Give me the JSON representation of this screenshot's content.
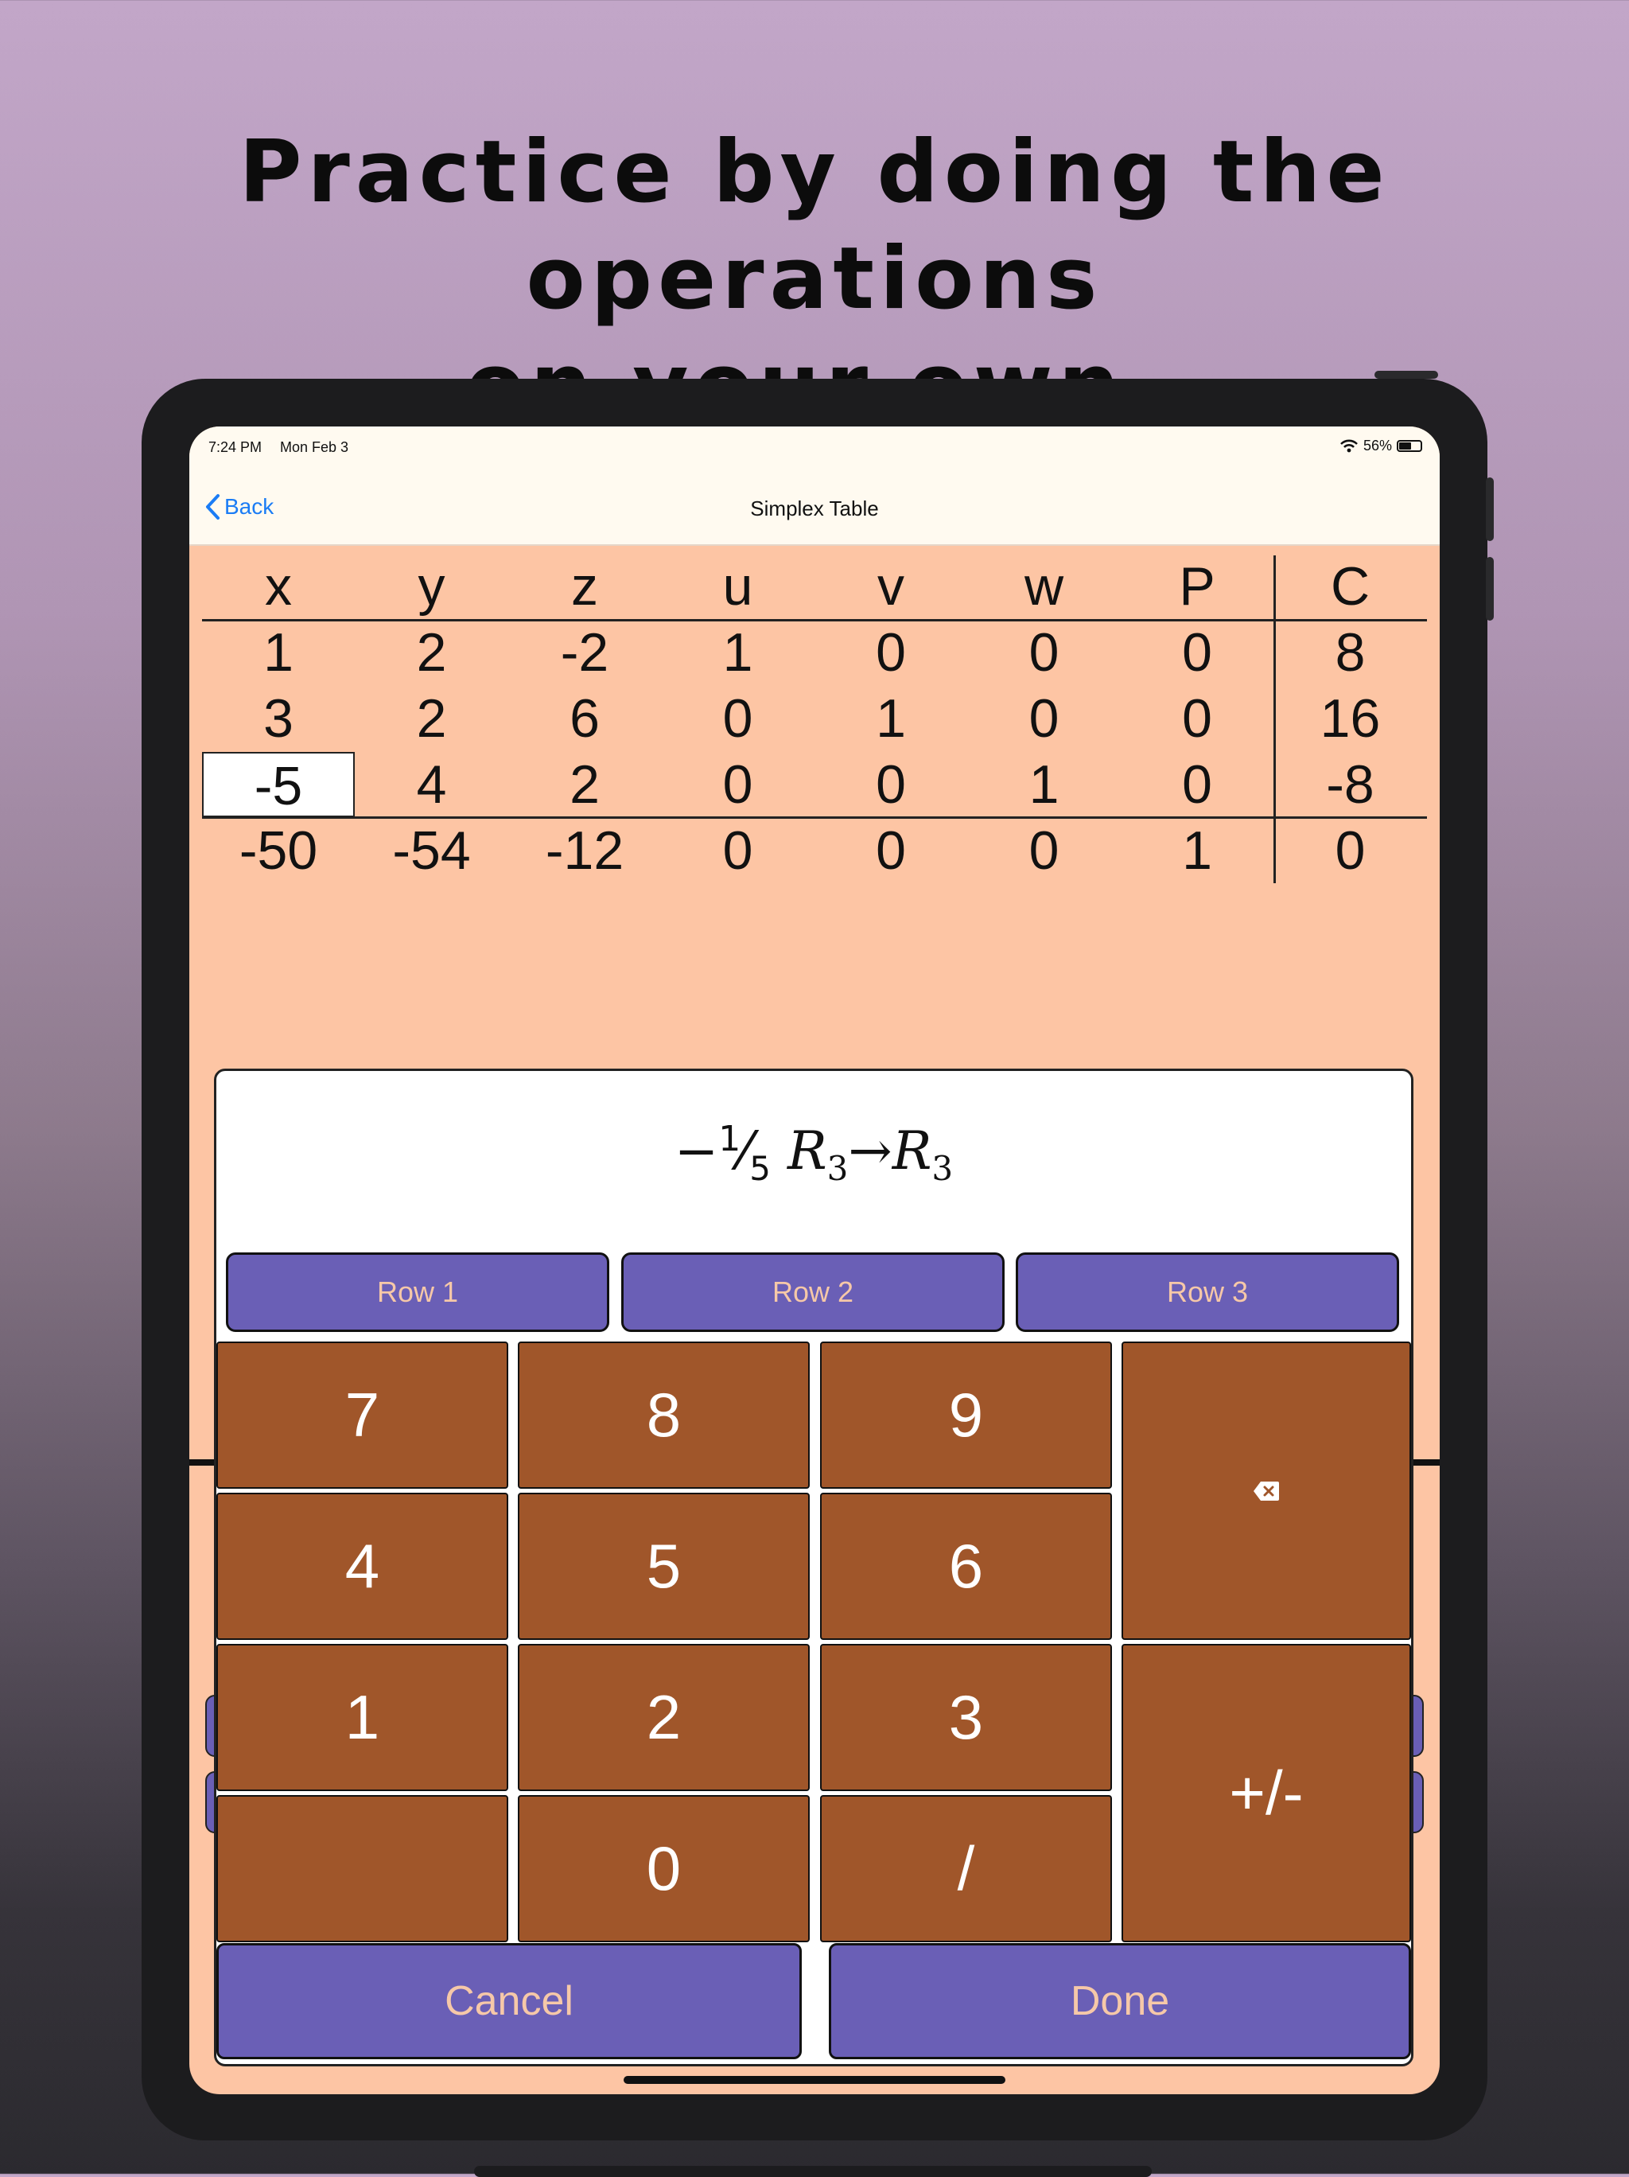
{
  "caption": {
    "line1": "Practice by doing the operations",
    "line2": "on your own."
  },
  "status_bar": {
    "time": "7:24 PM",
    "date": "Mon Feb 3",
    "battery": "56%"
  },
  "nav": {
    "back_label": "Back",
    "title": "Simplex Table"
  },
  "tableau": {
    "headers": [
      "x",
      "y",
      "z",
      "u",
      "v",
      "w",
      "P",
      "C"
    ],
    "rows": [
      [
        "1",
        "2",
        "-2",
        "1",
        "0",
        "0",
        "0",
        "8"
      ],
      [
        "3",
        "2",
        "6",
        "0",
        "1",
        "0",
        "0",
        "16"
      ],
      [
        "-5",
        "4",
        "2",
        "0",
        "0",
        "1",
        "0",
        "-8"
      ],
      [
        "-50",
        "-54",
        "-12",
        "0",
        "0",
        "0",
        "1",
        "0"
      ]
    ],
    "selected_cell": {
      "row": 2,
      "col": 0
    }
  },
  "operation": {
    "sign": "−",
    "numerator": "1",
    "denominator": "5",
    "row_var": "R",
    "row_sub": "3",
    "arrow": "→",
    "target_var": "R",
    "target_sub": "3"
  },
  "row_buttons": [
    "Row 1",
    "Row 2",
    "Row 3"
  ],
  "keypad": {
    "k7": "7",
    "k8": "8",
    "k9": "9",
    "k4": "4",
    "k5": "5",
    "k6": "6",
    "k1": "1",
    "k2": "2",
    "k3": "3",
    "k0": "0",
    "slash": "/",
    "plusminus": "+/-",
    "backspace_icon": "delete-backward-icon"
  },
  "actions": {
    "cancel": "Cancel",
    "done": "Done"
  },
  "colors": {
    "screen_bg": "#fdc5a4",
    "key_bg": "#a0562a",
    "button_bg": "#6a5fb6",
    "button_text": "#f6c8a8",
    "link": "#1b7cf5"
  }
}
